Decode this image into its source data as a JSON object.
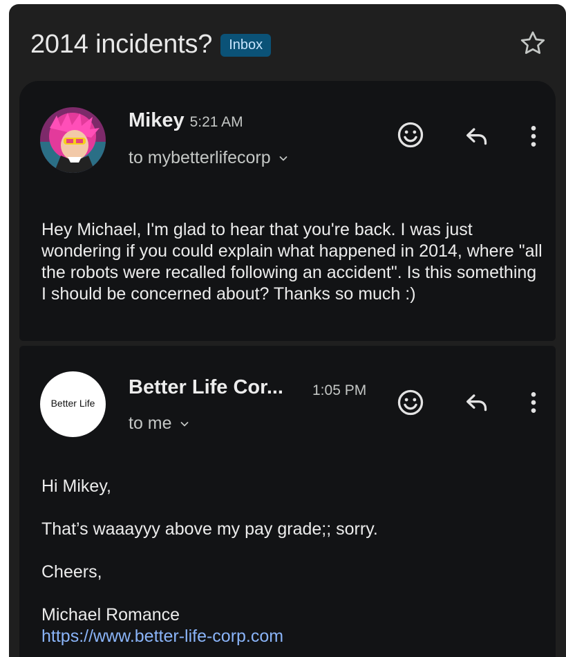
{
  "thread": {
    "subject": "2014 incidents?",
    "label": "Inbox",
    "star_icon": "star-outline-icon"
  },
  "messages": [
    {
      "sender": "Mikey",
      "time": "5:21 AM",
      "recipient": "to mybetterlifecorp",
      "avatar": "illustrated-pink-haired-character",
      "body": [
        "Hey Michael, I'm glad to hear that you're back. I was just wondering if you could explain what happened in 2014, where \"all the robots were recalled following an accident\". Is this something I should be concerned about? Thanks so much :)"
      ]
    },
    {
      "sender": "Better Life Cor...",
      "time": "1:05 PM",
      "recipient": "to me",
      "avatar_text": "Better Life",
      "body": [
        "Hi Mikey,",
        "That’s waaayyy above my pay grade;; sorry.",
        "Cheers,"
      ],
      "signature_name": "Michael Romance",
      "signature_link": "https://www.better-life-corp.com"
    }
  ],
  "actions": {
    "react_icon": "smiley-icon",
    "reply_icon": "reply-arrow-icon",
    "more_icon": "vertical-dots-icon"
  },
  "colors": {
    "background": "#1f1f1f",
    "card": "#121315",
    "label_bg": "#0b5277",
    "label_text": "#c9e6ff",
    "link": "#8ab4f8"
  }
}
